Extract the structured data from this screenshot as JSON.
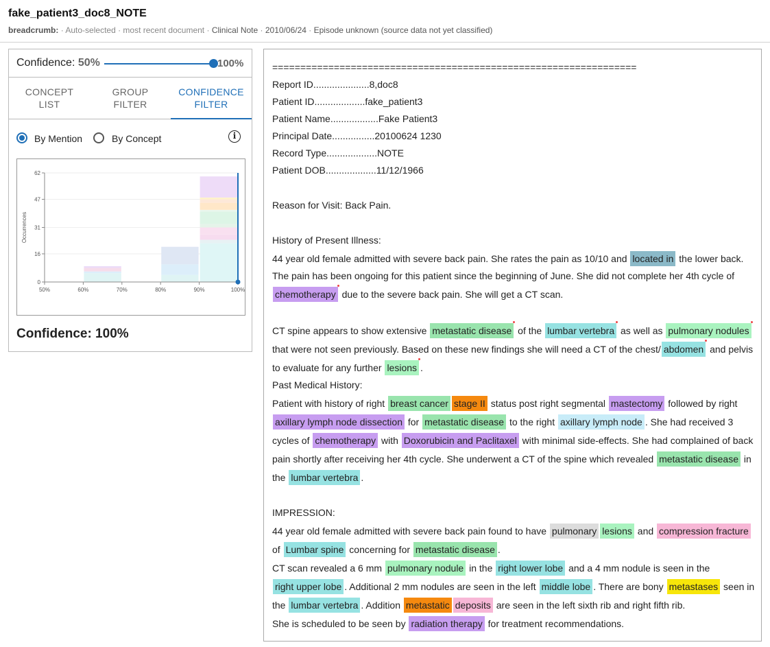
{
  "header": {
    "title": "fake_patient3_doc8_NOTE",
    "breadcrumb_label": "breadcrumb:",
    "breadcrumb_auto": "· Auto-selected · most recent document ·",
    "breadcrumb_type": "Clinical Note",
    "breadcrumb_sep": "·",
    "breadcrumb_date": "2010/06/24",
    "breadcrumb_sep2": "·",
    "breadcrumb_episode": "Episode unknown (source data not yet classified)"
  },
  "confidence_slider": {
    "label": "Confidence:",
    "min_label": "50%",
    "max_label": "100%",
    "value_fraction": 1.0
  },
  "tabs": [
    {
      "label": "CONCEPT LIST"
    },
    {
      "label": "GROUP FILTER"
    },
    {
      "label": "CONFIDENCE FILTER"
    }
  ],
  "active_tab": "CONFIDENCE FILTER",
  "radio": {
    "by_mention": "By Mention",
    "by_concept": "By Concept",
    "selected": "By Mention"
  },
  "info_icon_glyph": "i",
  "chart_data": {
    "type": "bar",
    "ylabel": "Occurrences",
    "xlabel": "",
    "x_ticks": [
      "50%",
      "60%",
      "70%",
      "80%",
      "90%",
      "100%"
    ],
    "y_ticks": [
      "0",
      "16",
      "31",
      "47",
      "62"
    ],
    "ylim": [
      0,
      62
    ],
    "xlim": [
      50,
      100
    ],
    "series_bins": [
      {
        "range": [
          60,
          70
        ],
        "segments": [
          {
            "value": 5,
            "color": "#dff4f4"
          },
          {
            "value": 1,
            "color": "#dceefa"
          },
          {
            "value": 2,
            "color": "#f6dcea"
          },
          {
            "value": 1,
            "color": "#ecdcf8"
          }
        ]
      },
      {
        "range": [
          80,
          90
        ],
        "segments": [
          {
            "value": 4,
            "color": "#dff4f4"
          },
          {
            "value": 6,
            "color": "#dceefa"
          },
          {
            "value": 10,
            "color": "#dfe7f4"
          }
        ]
      },
      {
        "range": [
          90,
          100
        ],
        "segments": [
          {
            "value": 22,
            "color": "#dff6f6"
          },
          {
            "value": 2,
            "color": "#e7f2f4"
          },
          {
            "value": 3,
            "color": "#f7dcef"
          },
          {
            "value": 4,
            "color": "#f9e0f0"
          },
          {
            "value": 2,
            "color": "#e5f4e9"
          },
          {
            "value": 7,
            "color": "#ddf5e6"
          },
          {
            "value": 1,
            "color": "#e9f6ed"
          },
          {
            "value": 4,
            "color": "#ffe7c8"
          },
          {
            "value": 2,
            "color": "#fde8d9"
          },
          {
            "value": 1,
            "color": "#fff3c9"
          },
          {
            "value": 12,
            "color": "#eedcf8"
          }
        ]
      }
    ],
    "threshold": 100,
    "threshold_color": "#1f6fb7"
  },
  "confidence_readout": "Confidence: 100%",
  "document": {
    "lines": [
      [
        {
          "t": "================================================================="
        }
      ],
      [
        {
          "t": "Report ID.....................8,doc8"
        }
      ],
      [
        {
          "t": "Patient ID...................fake_patient3"
        }
      ],
      [
        {
          "t": "Patient Name..................Fake Patient3"
        }
      ],
      [
        {
          "t": "Principal Date................20100624 1230"
        }
      ],
      [
        {
          "t": "Record Type...................NOTE"
        }
      ],
      [
        {
          "t": "Patient DOB...................11/12/1966"
        }
      ],
      [],
      [
        {
          "t": "Reason for Visit:  Back Pain."
        }
      ],
      [],
      [
        {
          "t": "History of Present Illness:"
        }
      ],
      [
        {
          "t": "44 year old female admitted with severe back pain. She rates the pain as 10/10 and "
        },
        {
          "t": "located in",
          "c": "slate"
        },
        {
          "t": " the lower back."
        }
      ],
      [
        {
          "t": "The pain has been ongoing for this patient since the beginning of June. She did not complete her 4th cycle of"
        }
      ],
      [
        {
          "t": "chemotherapy",
          "c": "purple",
          "dot": true
        },
        {
          "t": " due to the severe back pain. She will get a CT scan."
        }
      ],
      [],
      [
        {
          "t": "CT spine appears to show extensive "
        },
        {
          "t": "metastatic disease",
          "c": "green",
          "dot": true
        },
        {
          "t": " of the "
        },
        {
          "t": "lumbar vertebra",
          "c": "teal",
          "dot": true
        },
        {
          "t": " as well as "
        },
        {
          "t": "pulmonary nodules",
          "c": "lgreen",
          "dot": true
        }
      ],
      [
        {
          "t": "that were not seen previously. Based on these new findings she will need a CT of the chest/"
        },
        {
          "t": "abdomen",
          "c": "teal",
          "dot": true
        },
        {
          "t": " and pelvis"
        }
      ],
      [
        {
          "t": "to evaluate for any further "
        },
        {
          "t": "lesions",
          "c": "lgreen",
          "dot": true
        },
        {
          "t": "."
        }
      ],
      [
        {
          "t": "Past Medical History:"
        }
      ],
      [
        {
          "t": "Patient with history of right "
        },
        {
          "t": "breast cancer",
          "c": "green"
        },
        {
          "t": "stage II",
          "c": "orange"
        },
        {
          "t": " status post right segmental "
        },
        {
          "t": "mastectomy",
          "c": "purple"
        },
        {
          "t": " followed by right"
        }
      ],
      [
        {
          "t": "axillary lymph node dissection",
          "c": "purple"
        },
        {
          "t": " for "
        },
        {
          "t": "metastatic disease",
          "c": "green"
        },
        {
          "t": " to the right "
        },
        {
          "t": "axillary lymph node",
          "c": "lblue"
        },
        {
          "t": ". She had received 3"
        }
      ],
      [
        {
          "t": "cycles of "
        },
        {
          "t": "chemotherapy",
          "c": "purple"
        },
        {
          "t": " with "
        },
        {
          "t": "Doxorubicin and Paclitaxel",
          "c": "purple"
        },
        {
          "t": " with minimal side-effects. She had complained of back"
        }
      ],
      [
        {
          "t": "pain shortly after receiving her 4th cycle. She underwent a CT of the spine which revealed "
        },
        {
          "t": "metastatic disease",
          "c": "green"
        },
        {
          "t": " in"
        }
      ],
      [
        {
          "t": "the "
        },
        {
          "t": "lumbar vertebra",
          "c": "teal"
        },
        {
          "t": "."
        }
      ],
      [],
      [
        {
          "t": "IMPRESSION:"
        }
      ],
      [
        {
          "t": "44 year old female admitted with severe back pain found to have "
        },
        {
          "t": "pulmonary",
          "c": "gray"
        },
        {
          "t": "lesions",
          "c": "lgreen"
        },
        {
          "t": " and "
        },
        {
          "t": "compression fracture",
          "c": "pink"
        }
      ],
      [
        {
          "t": "of "
        },
        {
          "t": "Lumbar spine",
          "c": "teal"
        },
        {
          "t": " concerning for "
        },
        {
          "t": "metastatic disease",
          "c": "green"
        },
        {
          "t": "."
        }
      ],
      [
        {
          "t": "CT scan revealed a 6 mm "
        },
        {
          "t": "pulmonary nodule",
          "c": "lgreen"
        },
        {
          "t": " in the "
        },
        {
          "t": "right lower lobe",
          "c": "teal"
        },
        {
          "t": " and a 4 mm nodule is seen in the"
        }
      ],
      [
        {
          "t": "right upper lobe",
          "c": "teal"
        },
        {
          "t": ".  Additional 2 mm nodules are seen in the left "
        },
        {
          "t": "middle lobe",
          "c": "teal"
        },
        {
          "t": ". There are bony "
        },
        {
          "t": "metastases",
          "c": "yellow"
        },
        {
          "t": " seen in"
        }
      ],
      [
        {
          "t": "the "
        },
        {
          "t": "lumbar vertebra",
          "c": "teal"
        },
        {
          "t": ". Addition "
        },
        {
          "t": "metastatic",
          "c": "orange"
        },
        {
          "t": "deposits",
          "c": "pink"
        },
        {
          "t": " are seen in the left sixth rib and right fifth rib."
        }
      ],
      [
        {
          "t": "She is scheduled to be seen by "
        },
        {
          "t": "radiation therapy",
          "c": "purple"
        },
        {
          "t": " for treatment recommendations."
        }
      ]
    ]
  }
}
